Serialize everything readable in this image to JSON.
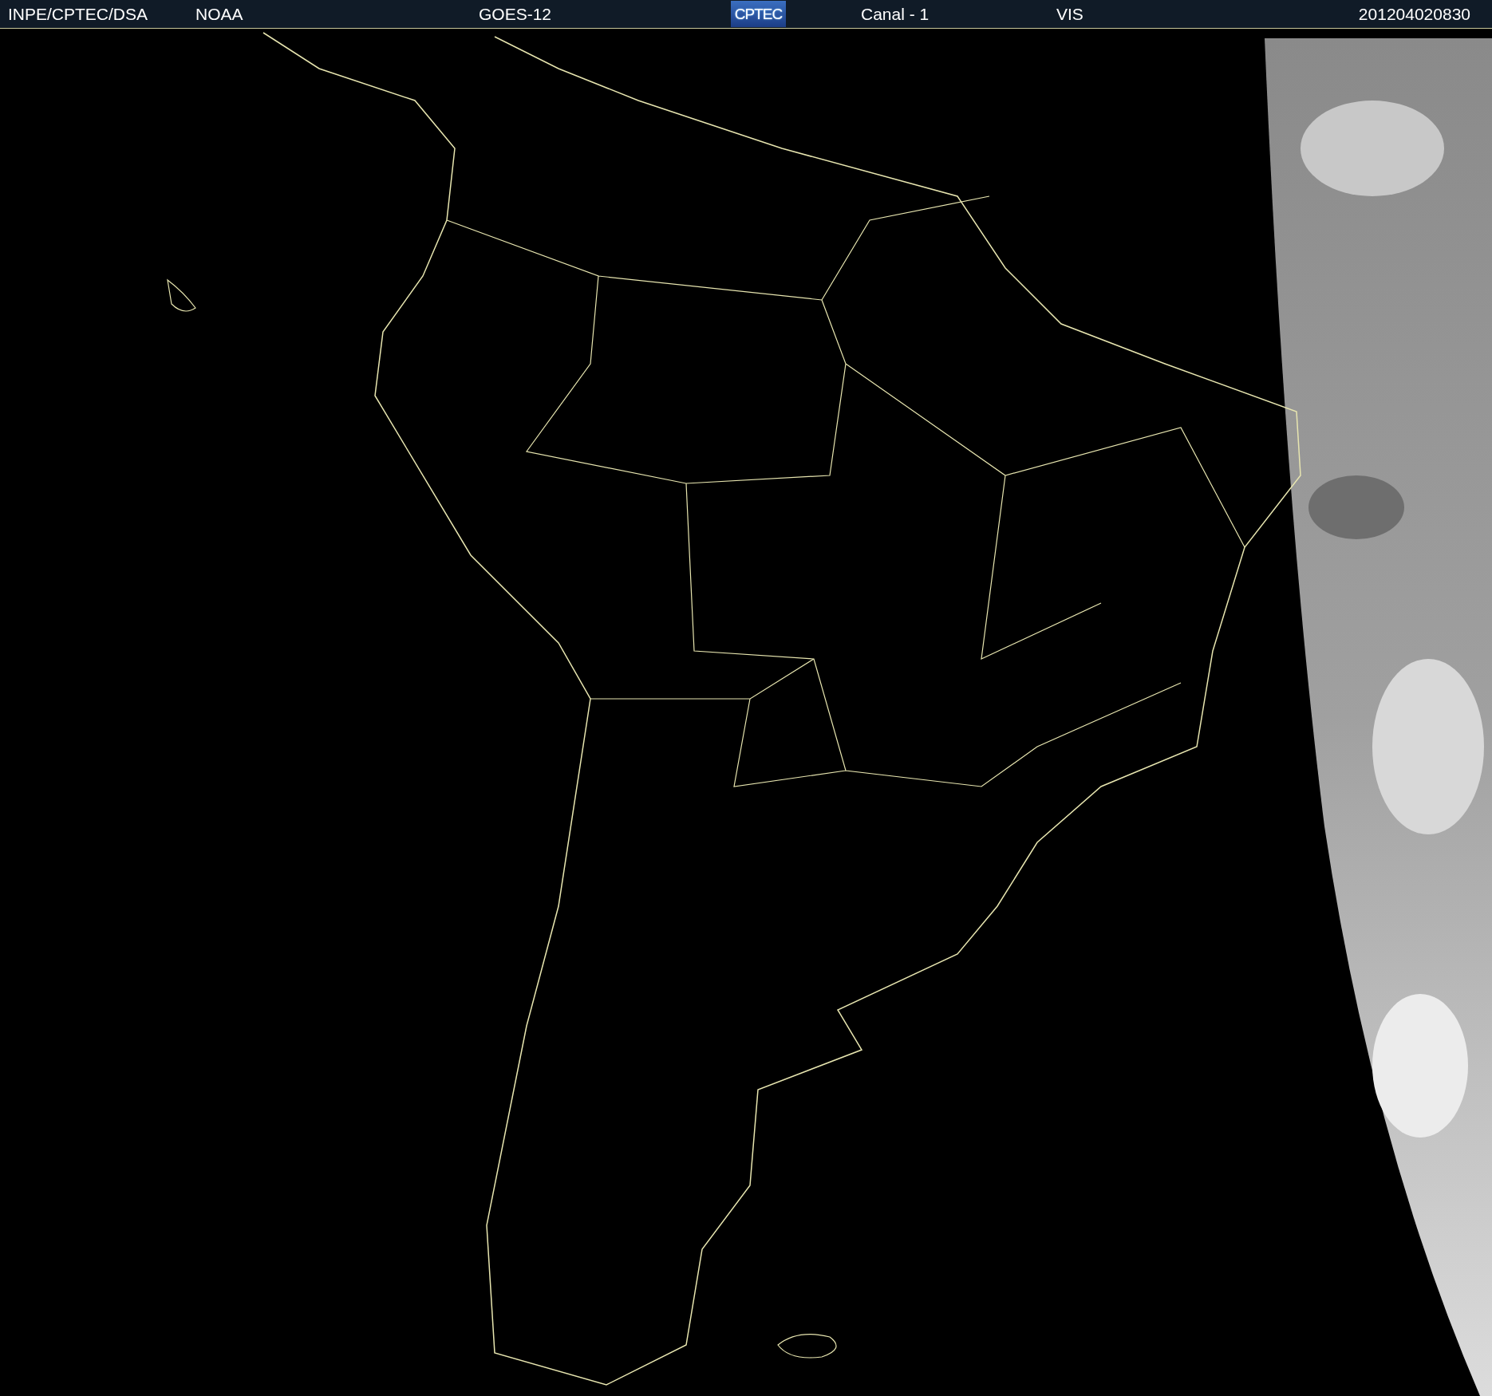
{
  "header": {
    "items": [
      {
        "kind": "text",
        "label": "INPE/CPTEC/DSA"
      },
      {
        "kind": "text",
        "label": "NOAA"
      },
      {
        "kind": "text",
        "label": "GOES-12"
      },
      {
        "kind": "logo",
        "label": "CPTEC"
      },
      {
        "kind": "text",
        "label": "Canal - 1"
      },
      {
        "kind": "text",
        "label": "VIS"
      },
      {
        "kind": "text",
        "label": "201204020830"
      }
    ]
  }
}
